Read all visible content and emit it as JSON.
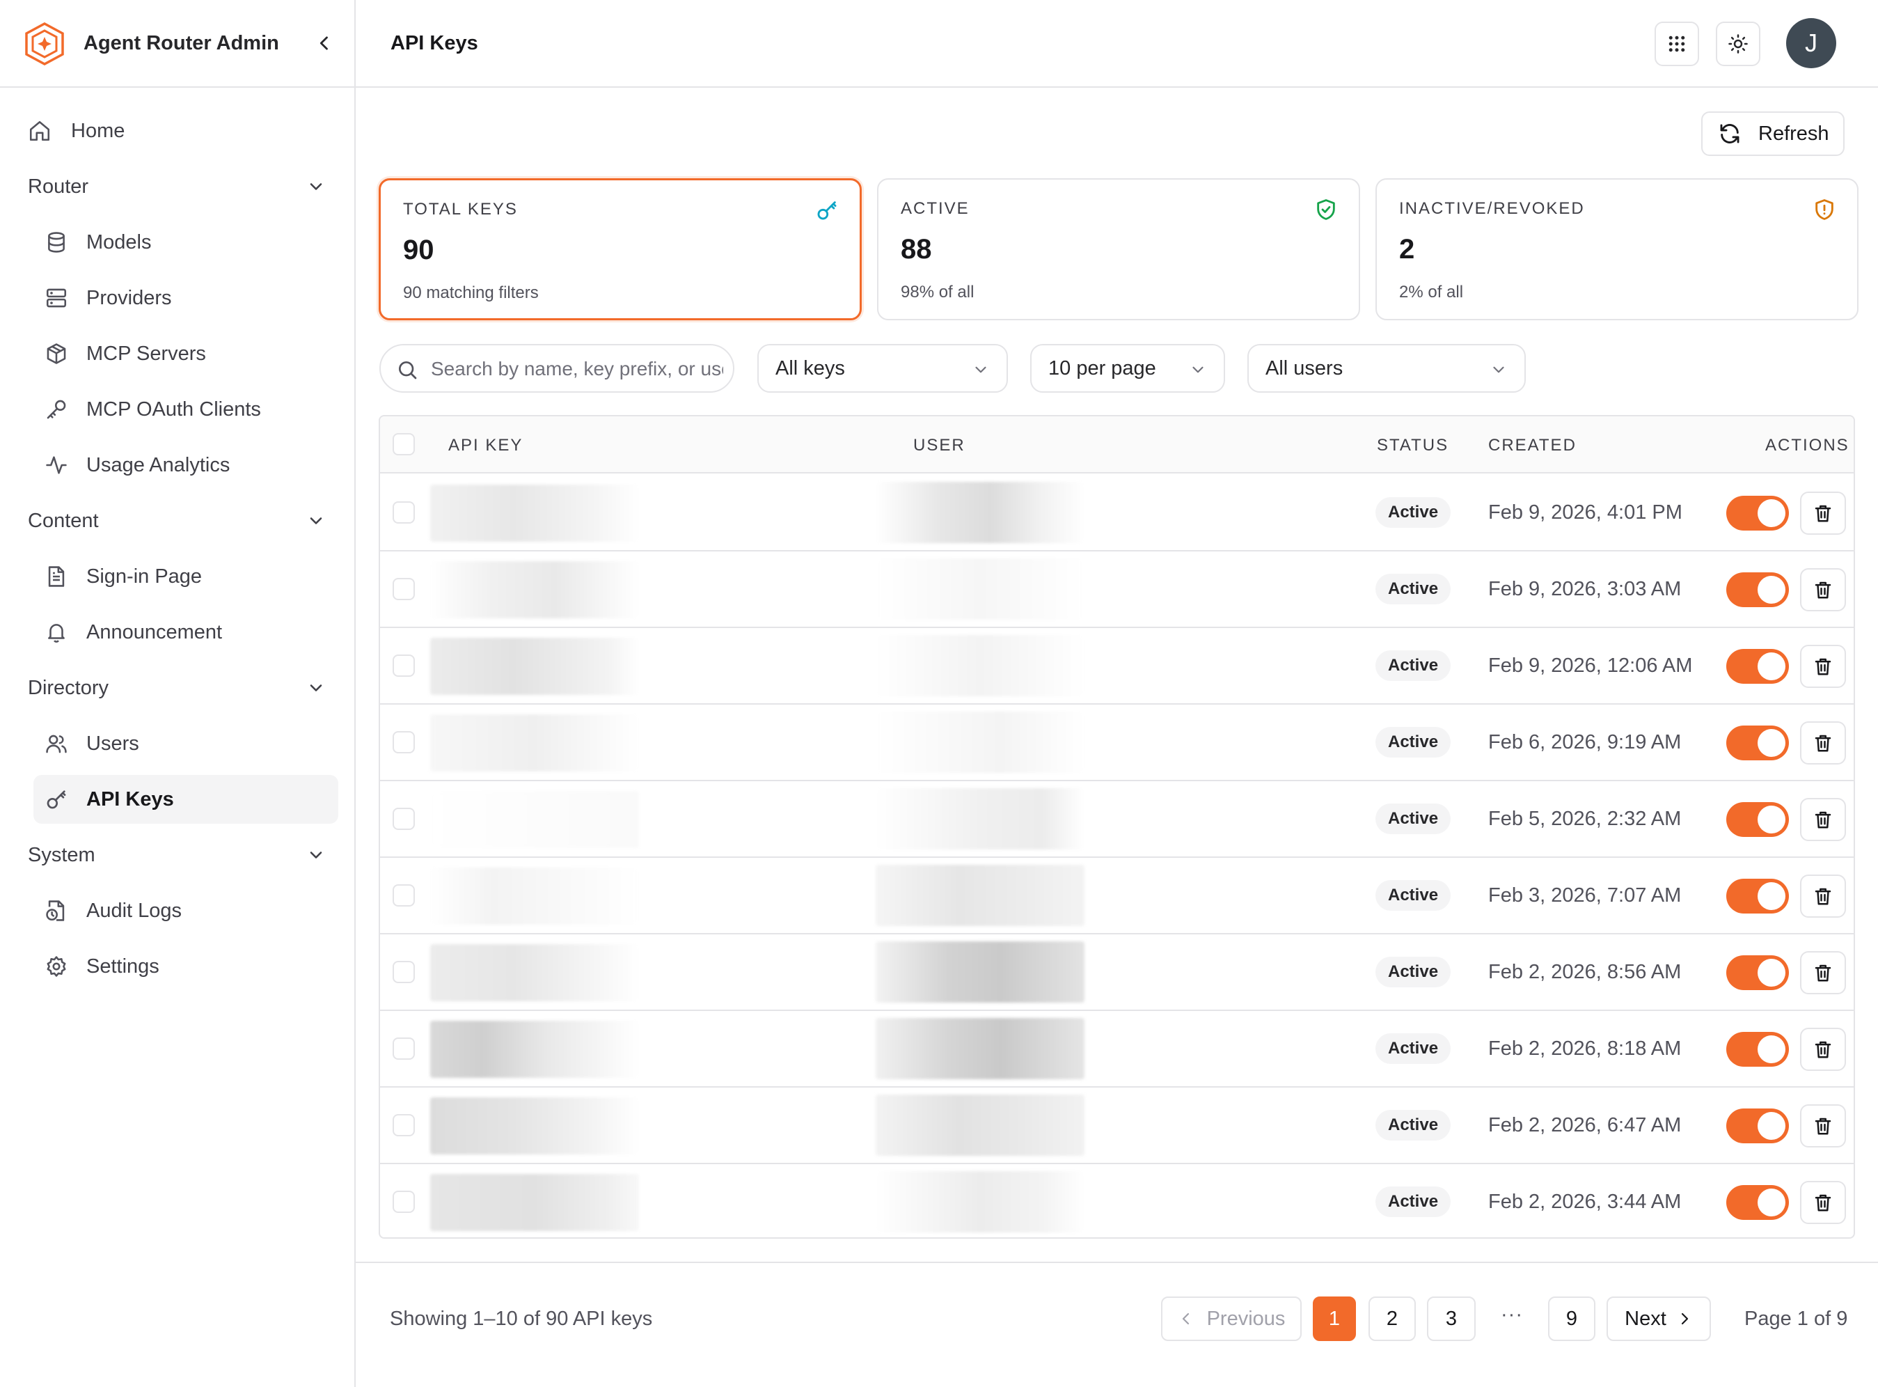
{
  "app": {
    "title": "Agent Router Admin",
    "collapse_icon": "chevron-left-icon"
  },
  "sidebar": {
    "home": {
      "label": "Home",
      "icon": "home-icon"
    },
    "sections": [
      {
        "label": "Router",
        "items": [
          {
            "label": "Models",
            "icon": "database-icon"
          },
          {
            "label": "Providers",
            "icon": "server-icon"
          },
          {
            "label": "MCP Servers",
            "icon": "package-icon"
          },
          {
            "label": "MCP OAuth Clients",
            "icon": "key-icon"
          },
          {
            "label": "Usage Analytics",
            "icon": "activity-icon"
          }
        ]
      },
      {
        "label": "Content",
        "items": [
          {
            "label": "Sign-in Page",
            "icon": "file-text-icon"
          },
          {
            "label": "Announcement",
            "icon": "bell-icon"
          }
        ]
      },
      {
        "label": "Directory",
        "items": [
          {
            "label": "Users",
            "icon": "users-icon"
          },
          {
            "label": "API Keys",
            "icon": "key-round-icon",
            "active": true
          }
        ]
      },
      {
        "label": "System",
        "items": [
          {
            "label": "Audit Logs",
            "icon": "file-clock-icon"
          },
          {
            "label": "Settings",
            "icon": "gear-icon"
          }
        ]
      }
    ]
  },
  "header": {
    "title": "API Keys",
    "avatar_initial": "J"
  },
  "toolbar": {
    "refresh_label": "Refresh"
  },
  "stats": [
    {
      "label": "TOTAL KEYS",
      "value": "90",
      "sub": "90 matching filters",
      "icon": "key-icon",
      "color": "#0ea5c6",
      "selected": true
    },
    {
      "label": "ACTIVE",
      "value": "88",
      "sub": "98% of all",
      "icon": "shield-check-icon",
      "color": "#16a34a"
    },
    {
      "label": "INACTIVE/REVOKED",
      "value": "2",
      "sub": "2% of all",
      "icon": "shield-alert-icon",
      "color": "#d97706"
    }
  ],
  "filters": {
    "search_placeholder": "Search by name, key prefix, or user",
    "status_value": "All keys",
    "per_page_value": "10 per page",
    "user_value": "All users"
  },
  "table": {
    "headers": {
      "api_key": "API KEY",
      "user": "USER",
      "status": "STATUS",
      "created": "CREATED",
      "actions": "ACTIONS"
    },
    "rows": [
      {
        "status": "Active",
        "created": "Feb 9, 2026, 4:01 PM",
        "enabled": true
      },
      {
        "status": "Active",
        "created": "Feb 9, 2026, 3:03 AM",
        "enabled": true
      },
      {
        "status": "Active",
        "created": "Feb 9, 2026, 12:06 AM",
        "enabled": true
      },
      {
        "status": "Active",
        "created": "Feb 6, 2026, 9:19 AM",
        "enabled": true
      },
      {
        "status": "Active",
        "created": "Feb 5, 2026, 2:32 AM",
        "enabled": true
      },
      {
        "status": "Active",
        "created": "Feb 3, 2026, 7:07 AM",
        "enabled": true
      },
      {
        "status": "Active",
        "created": "Feb 2, 2026, 8:56 AM",
        "enabled": true
      },
      {
        "status": "Active",
        "created": "Feb 2, 2026, 8:18 AM",
        "enabled": true
      },
      {
        "status": "Active",
        "created": "Feb 2, 2026, 6:47 AM",
        "enabled": true
      },
      {
        "status": "Active",
        "created": "Feb 2, 2026, 3:44 AM",
        "enabled": true
      }
    ]
  },
  "pagination": {
    "showing": "Showing 1–10 of 90 API keys",
    "previous": "Previous",
    "next": "Next",
    "pages": [
      "1",
      "2",
      "3",
      "9"
    ],
    "ellipsis": "···",
    "current": "1",
    "page_of": "Page 1 of 9"
  },
  "colors": {
    "accent": "#f26a2a",
    "border": "#e4e4e7"
  }
}
